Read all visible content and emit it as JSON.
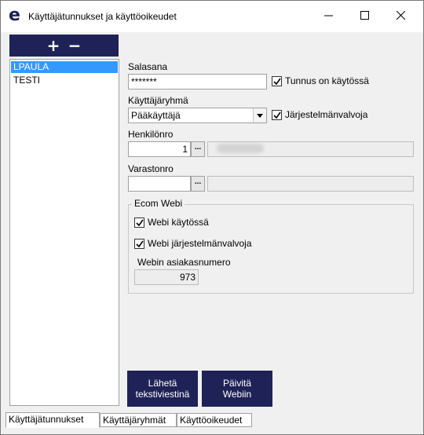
{
  "window": {
    "title": "Käyttäjätunnukset ja käyttöoikeudet",
    "app_icon_glyph": "e",
    "controls": {
      "minimize": "minimize-icon",
      "maximize": "maximize-icon",
      "close": "close-icon"
    }
  },
  "toolbar": {
    "add_glyph": "+",
    "remove_glyph": "−"
  },
  "users": [
    {
      "name": "LPAULA",
      "selected": true
    },
    {
      "name": "TESTI",
      "selected": false
    }
  ],
  "form": {
    "password_label": "Salasana",
    "password_value": "*******",
    "account_enabled_label": "Tunnus on käytössä",
    "account_enabled": true,
    "user_group_label": "Käyttäjäryhmä",
    "user_group_value": "Pääkäyttäjä",
    "sysadmin_label": "Järjestelmänvalvoja",
    "sysadmin": true,
    "person_no_label": "Henkilönro",
    "person_no_value": "1",
    "warehouse_no_label": "Varastonro",
    "warehouse_no_value": "",
    "lookup_glyph": "..."
  },
  "ecom": {
    "group_title": "Ecom Webi",
    "web_enabled_label": "Webi käytössä",
    "web_enabled": true,
    "web_sysadmin_label": "Webi järjestelmänvalvoja",
    "web_sysadmin": true,
    "customer_no_label": "Webin asiakasnumero",
    "customer_no_value": "973"
  },
  "actions": {
    "send_sms": [
      "Lähetä",
      "tekstiviestinä"
    ],
    "update_web": [
      "Päivitä",
      "Webiin"
    ]
  },
  "tabs": [
    {
      "label": "Käyttäjätunnukset",
      "active": true
    },
    {
      "label": "Käyttäjäryhmät",
      "active": false
    },
    {
      "label": "Käyttöoikeudet",
      "active": false
    }
  ],
  "colors": {
    "accent": "#1f2256",
    "selection": "#3399ff",
    "window_bg": "#f0f0f0"
  }
}
